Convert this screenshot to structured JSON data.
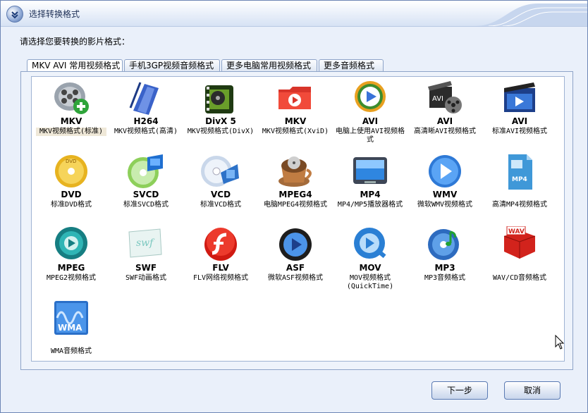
{
  "window": {
    "title": "选择转换格式"
  },
  "prompt": "请选择您要转换的影片格式：",
  "tabs": [
    {
      "label": "MKV AVI 常用视频格式",
      "active": true
    },
    {
      "label": "手机3GP视频音频格式",
      "active": false
    },
    {
      "label": "更多电脑常用视频格式",
      "active": false
    },
    {
      "label": "更多音频格式",
      "active": false
    }
  ],
  "formats": [
    {
      "code": "MKV",
      "desc": "MKV视频格式(标准)",
      "icon": "film-reel-plus-icon",
      "selected": true
    },
    {
      "code": "H264",
      "desc": "MKV视频格式(高清)",
      "icon": "blue-film-strip-icon"
    },
    {
      "code": "DivX 5",
      "desc": "MKV视频格式(DivX)",
      "icon": "film-reel-green-icon"
    },
    {
      "code": "MKV",
      "desc": "MKV视频格式(XviD)",
      "icon": "red-folder-play-icon"
    },
    {
      "code": "AVI",
      "desc": "电脑上使用AVI视频格式",
      "icon": "play-disc-icon"
    },
    {
      "code": "AVI",
      "desc": "高清晰AVI视频格式",
      "icon": "clapper-reel-icon"
    },
    {
      "code": "AVI",
      "desc": "标准AVI视频格式",
      "icon": "clapper-play-icon"
    },
    {
      "code": "DVD",
      "desc": "标准DVD格式",
      "icon": "gold-dvd-icon"
    },
    {
      "code": "SVCD",
      "desc": "标准SVCD格式",
      "icon": "green-disc-film-icon"
    },
    {
      "code": "VCD",
      "desc": "标准VCD格式",
      "icon": "silver-disc-film-icon"
    },
    {
      "code": "MPEG4",
      "desc": "电脑MPEG4视频格式",
      "icon": "coffee-cup-reel-icon"
    },
    {
      "code": "MP4",
      "desc": "MP4/MP5播放器格式",
      "icon": "media-player-icon"
    },
    {
      "code": "WMV",
      "desc": "微软WMV视频格式",
      "icon": "blue-play-circle-icon"
    },
    {
      "code": "",
      "desc": "高清MP4视频格式",
      "icon": "mp4-file-icon"
    },
    {
      "code": "MPEG",
      "desc": "MPEG2视频格式",
      "icon": "teal-ring-icon"
    },
    {
      "code": "SWF",
      "desc": "SWF动画格式",
      "icon": "swf-card-icon"
    },
    {
      "code": "FLV",
      "desc": "FLV网络视频格式",
      "icon": "flash-logo-icon"
    },
    {
      "code": "ASF",
      "desc": "微软ASF视频格式",
      "icon": "dark-play-circle-icon"
    },
    {
      "code": "MOV",
      "desc": "MOV视频格式(QuickTime)",
      "icon": "quicktime-icon"
    },
    {
      "code": "MP3",
      "desc": "MP3音频格式",
      "icon": "music-disc-icon"
    },
    {
      "code": "",
      "desc": "WAV/CD音频格式",
      "icon": "wav-cube-icon"
    },
    {
      "code": "",
      "desc": "WMA音频格式",
      "icon": "wma-wave-icon"
    }
  ],
  "icon_labels": {
    "mp4": "MP4",
    "swf": "swf",
    "wav": "WAV",
    "wma": "WMA",
    "avi": "AVI",
    "dvd": "DVD"
  },
  "buttons": {
    "next": "下一步",
    "cancel": "取消"
  },
  "colors": {
    "accent": "#6d86b5",
    "selected_bg": "#efe8d8"
  }
}
